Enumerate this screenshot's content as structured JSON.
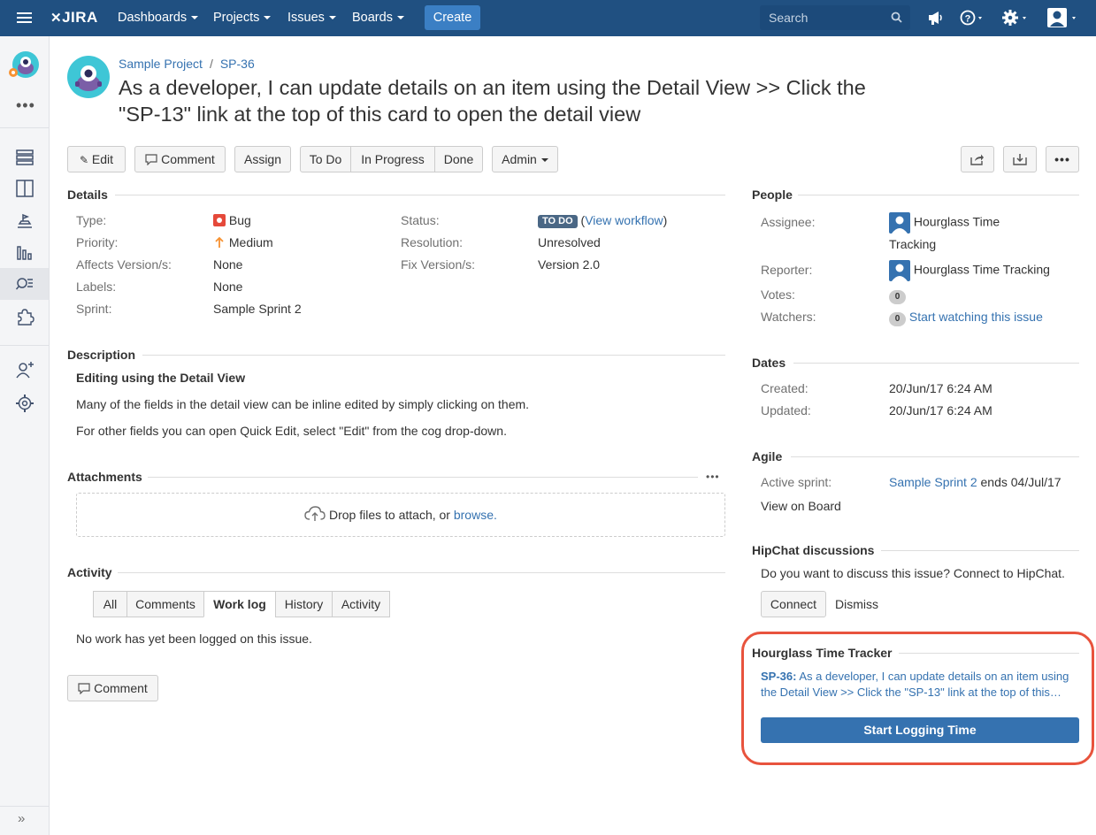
{
  "topnav": {
    "logo": "JIRA",
    "dashboards": "Dashboards",
    "projects": "Projects",
    "issues": "Issues",
    "boards": "Boards",
    "create": "Create",
    "search_placeholder": "Search"
  },
  "breadcrumb": {
    "project": "Sample Project",
    "issue_key": "SP-36"
  },
  "issue": {
    "summary": "As a developer, I can update details on an item using the Detail View >> Click the \"SP-13\" link at the top of this card to open the detail view"
  },
  "toolbar": {
    "edit": "Edit",
    "comment": "Comment",
    "assign": "Assign",
    "todo": "To Do",
    "in_progress": "In Progress",
    "done": "Done",
    "admin": "Admin"
  },
  "details": {
    "heading": "Details",
    "type_label": "Type:",
    "type_value": "Bug",
    "priority_label": "Priority:",
    "priority_value": "Medium",
    "affects_label": "Affects Version/s:",
    "affects_value": "None",
    "labels_label": "Labels:",
    "labels_value": "None",
    "sprint_label": "Sprint:",
    "sprint_value": "Sample Sprint 2",
    "status_label": "Status:",
    "status_value": "TO DO",
    "view_workflow": "View workflow",
    "resolution_label": "Resolution:",
    "resolution_value": "Unresolved",
    "fix_label": "Fix Version/s:",
    "fix_value": "Version 2.0"
  },
  "description": {
    "heading": "Description",
    "title": "Editing using the Detail View",
    "p1": "Many of the fields in the detail view can be inline edited by simply clicking on them.",
    "p2": "For other fields you can open Quick Edit, select \"Edit\" from the cog drop-down."
  },
  "attachments": {
    "heading": "Attachments",
    "drop_text": "Drop files to attach, or",
    "browse": "browse."
  },
  "activity": {
    "heading": "Activity",
    "tabs": [
      "All",
      "Comments",
      "Work log",
      "History",
      "Activity"
    ],
    "active_tab": "Work log",
    "empty": "No work has yet been logged on this issue.",
    "comment_button": "Comment"
  },
  "people": {
    "heading": "People",
    "assignee_label": "Assignee:",
    "assignee_line1": "Hourglass Time",
    "assignee_line2": "Tracking",
    "reporter_label": "Reporter:",
    "reporter_value": "Hourglass Time Tracking",
    "votes_label": "Votes:",
    "votes_count": "0",
    "watchers_label": "Watchers:",
    "watchers_count": "0",
    "watch_link": "Start watching this issue"
  },
  "dates": {
    "heading": "Dates",
    "created_label": "Created:",
    "created_value": "20/Jun/17 6:24 AM",
    "updated_label": "Updated:",
    "updated_value": "20/Jun/17 6:24 AM"
  },
  "agile": {
    "heading": "Agile",
    "active_sprint_label": "Active sprint:",
    "sprint_link": "Sample Sprint 2",
    "sprint_end": "ends 04/Jul/17",
    "view_on_board": "View on Board"
  },
  "hipchat": {
    "heading": "HipChat discussions",
    "question": "Do you want to discuss this issue? Connect to HipChat.",
    "connect": "Connect",
    "dismiss": "Dismiss"
  },
  "hourglass": {
    "heading": "Hourglass Time Tracker",
    "issue_key": "SP-36:",
    "line1": "As a developer, I can update details on an item using",
    "line2": "the Detail View >> Click the \"SP-13\" link at the top of this…",
    "start_button": "Start Logging Time"
  },
  "colors": {
    "nav_bg": "#205081",
    "link": "#3572b0",
    "create_btn": "#3b7fc4",
    "highlight_border": "#e8533d",
    "bug_red": "#e5493a",
    "priority_orange": "#f79232"
  }
}
